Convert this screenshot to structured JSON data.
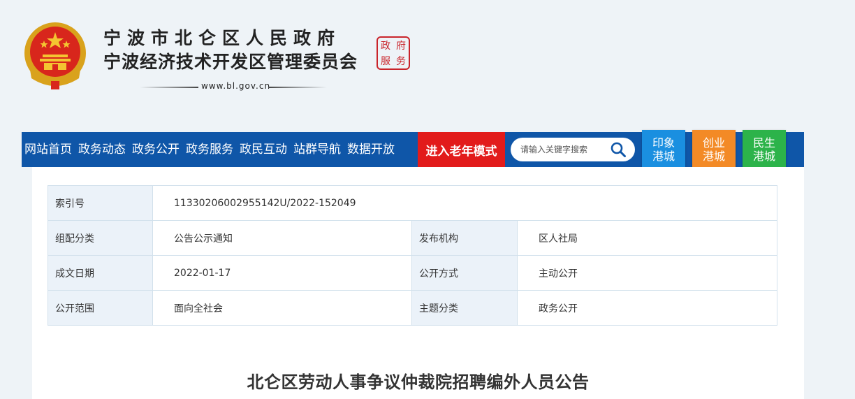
{
  "header": {
    "title_line1": "宁波市北仑区人民政府",
    "title_line2": "宁波经济技术开发区管理委员会",
    "domain": "www.bl.gov.cn",
    "seal_chars": [
      "政",
      "府",
      "服",
      "务"
    ]
  },
  "nav": {
    "items": [
      "网站首页",
      "政务动态",
      "政务公开",
      "政务服务",
      "政民互动",
      "站群导航",
      "数据开放"
    ],
    "elder_mode": "进入老年模式",
    "search_placeholder": "请输入关键字搜索"
  },
  "tiles": [
    {
      "label": "印象港城",
      "color": "#1a8fe0"
    },
    {
      "label": "创业港城",
      "color": "#f38a26"
    },
    {
      "label": "民生港城",
      "color": "#2cb34a"
    }
  ],
  "meta": {
    "index_label": "索引号",
    "index_value": "11330206002955142U/2022-152049",
    "category_label": "组配分类",
    "category_value": "公告公示通知",
    "publisher_label": "发布机构",
    "publisher_value": "区人社局",
    "date_label": "成文日期",
    "date_value": "2022-01-17",
    "method_label": "公开方式",
    "method_value": "主动公开",
    "scope_label": "公开范围",
    "scope_value": "面向全社会",
    "topic_label": "主题分类",
    "topic_value": "政务公开"
  },
  "article": {
    "title": "北仑区劳动人事争议仲裁院招聘编外人员公告"
  },
  "colors": {
    "nav_bg": "#0f56a8",
    "elder_bg": "#e21b1b",
    "label_cell_bg": "#ebf2f9"
  }
}
